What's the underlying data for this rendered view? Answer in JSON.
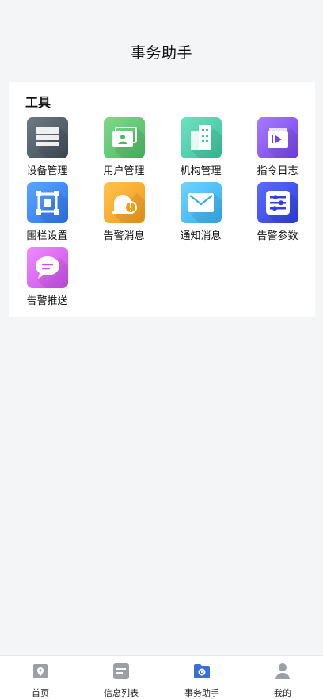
{
  "header": {
    "title": "事务助手"
  },
  "tools_section": {
    "title": "工具",
    "items": [
      {
        "label": "设备管理",
        "icon": "device-icon",
        "color": "#4f5b66"
      },
      {
        "label": "用户管理",
        "icon": "user-card-icon",
        "color": "#5cc773"
      },
      {
        "label": "机构管理",
        "icon": "building-icon",
        "color": "#4fd0ad"
      },
      {
        "label": "指令日志",
        "icon": "play-log-icon",
        "color": "#8a5cf5"
      },
      {
        "label": "围栏设置",
        "icon": "fence-square-icon",
        "color": "#3c86f7"
      },
      {
        "label": "告警消息",
        "icon": "alarm-bell-icon",
        "color": "#f5a623"
      },
      {
        "label": "通知消息",
        "icon": "mail-icon",
        "color": "#47bdf5"
      },
      {
        "label": "告警参数",
        "icon": "sliders-icon",
        "color": "#3a4aee"
      },
      {
        "label": "告警推送",
        "icon": "chat-bubble-icon",
        "color": "#d865ef"
      }
    ]
  },
  "tabbar": {
    "items": [
      {
        "label": "首页",
        "icon": "location-home-icon",
        "active": false
      },
      {
        "label": "信息列表",
        "icon": "document-list-icon",
        "active": false
      },
      {
        "label": "事务助手",
        "icon": "folder-gear-icon",
        "active": true
      },
      {
        "label": "我的",
        "icon": "person-icon",
        "active": false
      }
    ],
    "active_color": "#3a6fd8",
    "inactive_color": "#9aa0a6"
  }
}
